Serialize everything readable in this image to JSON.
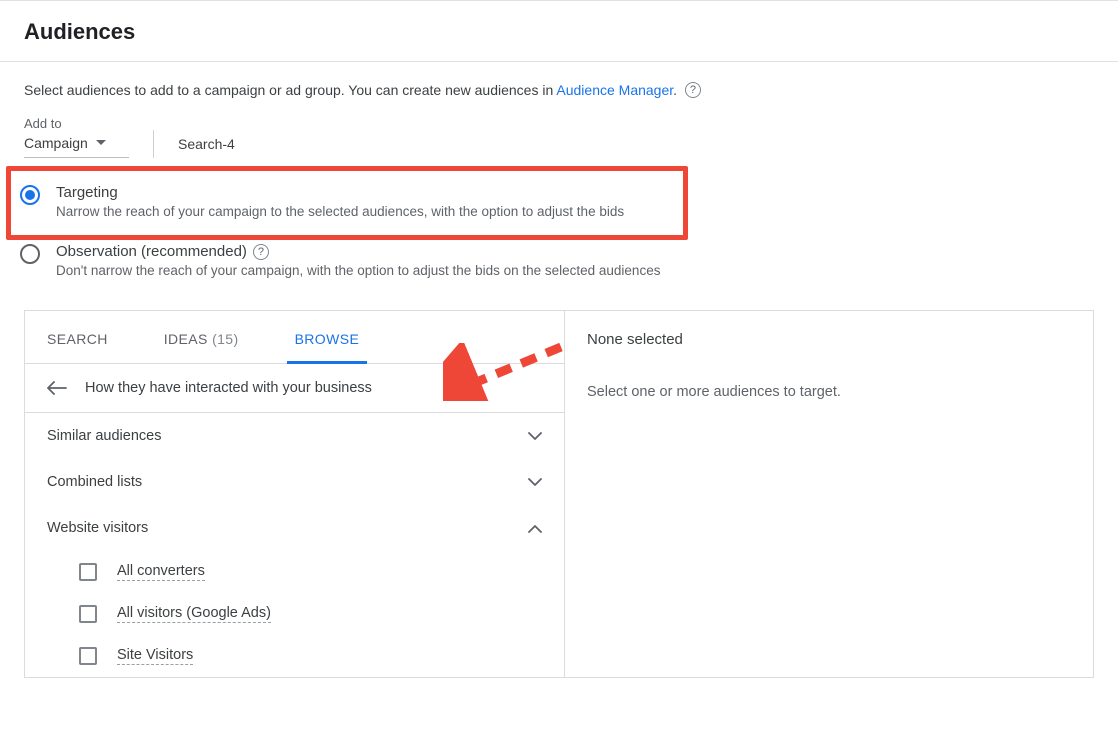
{
  "header": {
    "title": "Audiences"
  },
  "intro": {
    "text_before_link": "Select audiences to add to a campaign or ad group. You can create new audiences in ",
    "link_text": "Audience Manager",
    "text_after_link": "."
  },
  "add_to": {
    "label": "Add to",
    "selected": "Campaign",
    "campaign_name": "Search-4"
  },
  "radios": {
    "targeting": {
      "title": "Targeting",
      "desc": "Narrow the reach of your campaign to the selected audiences, with the option to adjust the bids"
    },
    "observation": {
      "title": "Observation (recommended)",
      "desc": "Don't narrow the reach of your campaign, with the option to adjust the bids on the selected audiences"
    }
  },
  "tabs": {
    "search": "Search",
    "ideas": "Ideas",
    "ideas_count": "(15)",
    "browse": "Browse"
  },
  "breadcrumb": "How they have interacted with your business",
  "categories": {
    "similar": "Similar audiences",
    "combined": "Combined lists",
    "website": "Website visitors"
  },
  "website_items": {
    "0": "All converters",
    "1": "All visitors (Google Ads)",
    "2": "Site Visitors"
  },
  "right_panel": {
    "title": "None selected",
    "desc": "Select one or more audiences to target."
  },
  "colors": {
    "accent": "#1a73e8",
    "highlight": "#ef4737"
  }
}
